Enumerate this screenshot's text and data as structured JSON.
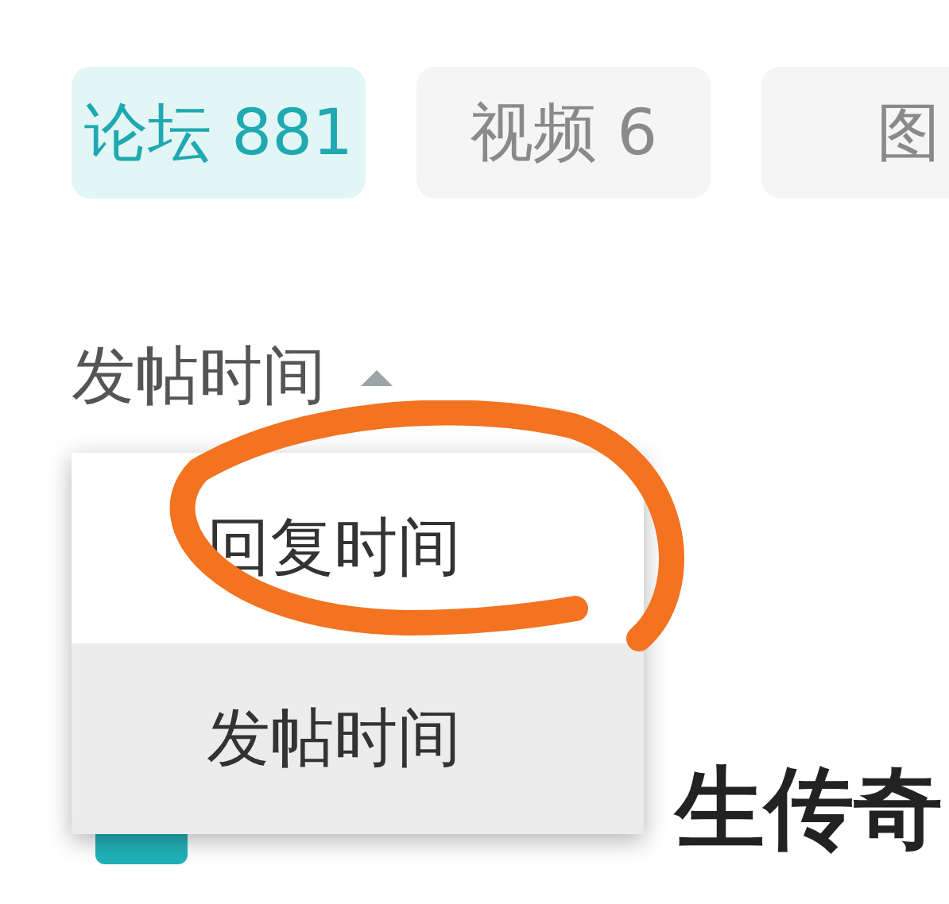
{
  "tabs": [
    {
      "label": "论坛",
      "count": "881",
      "selected": true
    },
    {
      "label": "视频",
      "count": "6",
      "selected": false
    },
    {
      "label": "图",
      "selected": false
    }
  ],
  "sort": {
    "label": "发帖时间",
    "expanded": true
  },
  "sort_menu": [
    {
      "label": "回复时间",
      "selected": false
    },
    {
      "label": "发帖时间",
      "selected": true
    }
  ],
  "post": {
    "title": "生传奇"
  }
}
